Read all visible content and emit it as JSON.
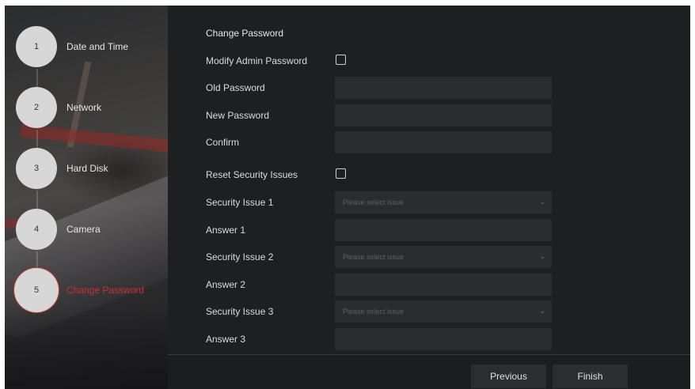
{
  "wizard": {
    "steps": [
      {
        "number": "1",
        "label": "Date and Time",
        "active": false
      },
      {
        "number": "2",
        "label": "Network",
        "active": false
      },
      {
        "number": "3",
        "label": "Hard Disk",
        "active": false
      },
      {
        "number": "4",
        "label": "Camera",
        "active": false
      },
      {
        "number": "5",
        "label": "Change Password",
        "active": true
      }
    ],
    "active_color": "#cf2f2f"
  },
  "form": {
    "heading": "Change Password",
    "modify_admin_password": {
      "label": "Modify Admin Password",
      "checked": false
    },
    "old_password": {
      "label": "Old Password",
      "value": ""
    },
    "new_password": {
      "label": "New Password",
      "value": ""
    },
    "confirm": {
      "label": "Confirm",
      "value": ""
    },
    "reset_security_issues": {
      "label": "Reset Security Issues",
      "checked": false
    },
    "security_issue_1": {
      "label": "Security Issue 1",
      "placeholder": "Please select issue"
    },
    "answer_1": {
      "label": "Answer 1",
      "value": ""
    },
    "security_issue_2": {
      "label": "Security Issue 2",
      "placeholder": "Please select issue"
    },
    "answer_2": {
      "label": "Answer 2",
      "value": ""
    },
    "security_issue_3": {
      "label": "Security Issue 3",
      "placeholder": "Please select issue"
    },
    "answer_3": {
      "label": "Answer 3",
      "value": ""
    }
  },
  "footer": {
    "previous_label": "Previous",
    "finish_label": "Finish"
  },
  "icons": {
    "dropdown": "chevron-down-icon",
    "checkbox": "checkbox-unchecked"
  }
}
